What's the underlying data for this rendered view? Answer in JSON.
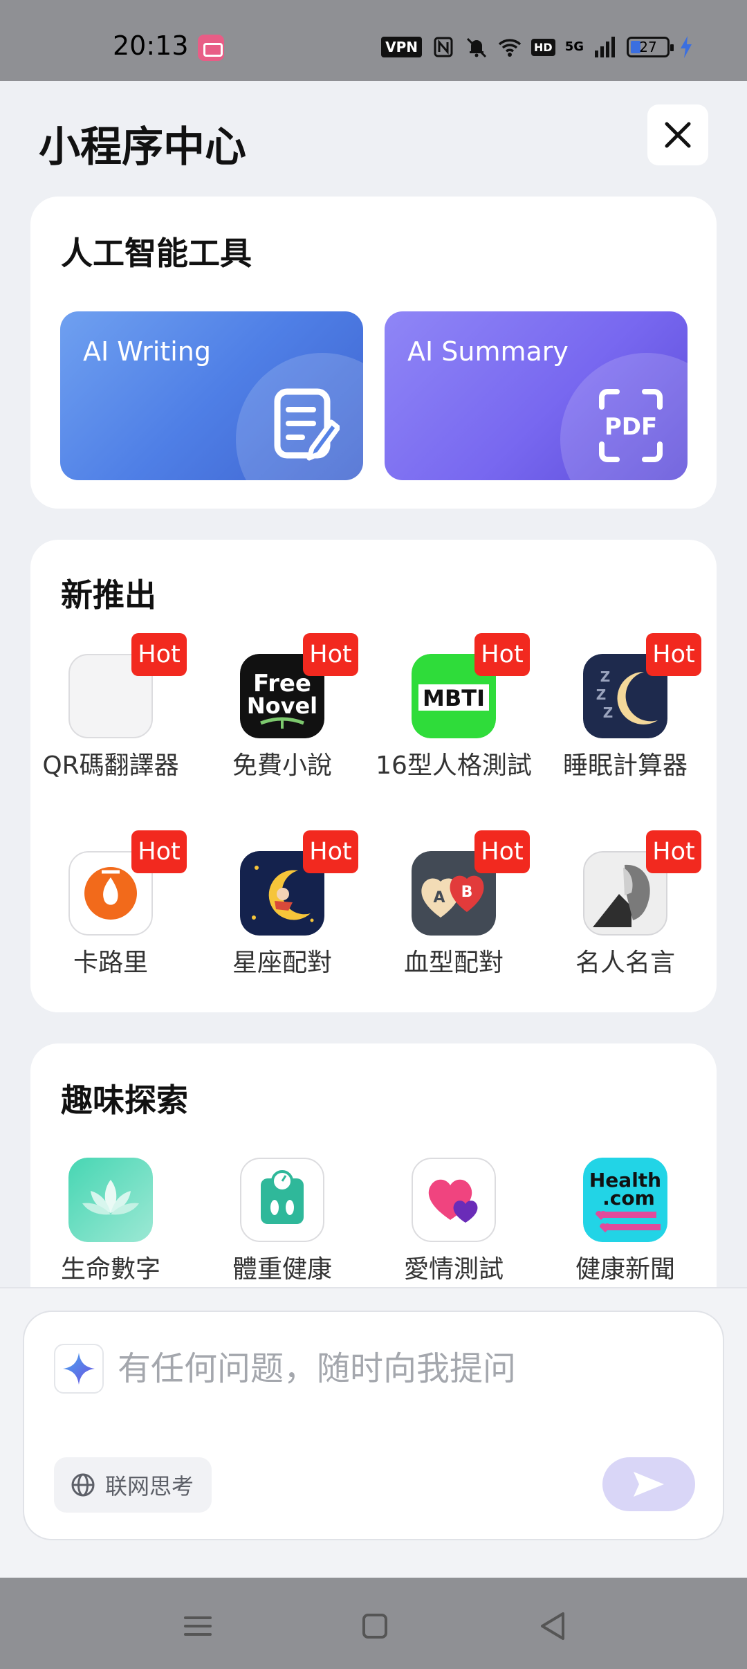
{
  "status": {
    "time": "20:13",
    "vpn": "VPN",
    "hd": "HD",
    "network": "5G",
    "battery": "27"
  },
  "header": {
    "title": "小程序中心"
  },
  "ai_tools": {
    "title": "人工智能工具",
    "tiles": [
      {
        "label": "AI Writing",
        "icon": "edit-document-icon"
      },
      {
        "label": "AI Summary",
        "icon": "pdf-icon"
      }
    ]
  },
  "new_release": {
    "title": "新推出",
    "hot_label": "Hot",
    "apps": [
      {
        "label": "QR碼翻譯器",
        "icon": "qr-translator-icon"
      },
      {
        "label": "免費小說",
        "icon": "free-novel-icon",
        "icon_text_1": "Free",
        "icon_text_2": "Novel"
      },
      {
        "label": "16型人格測試",
        "icon": "mbti-icon",
        "icon_text": "MBTI"
      },
      {
        "label": "睡眠計算器",
        "icon": "sleep-moon-icon",
        "icon_text": "Z Z Z"
      },
      {
        "label": "卡路里",
        "icon": "calorie-flame-icon"
      },
      {
        "label": "星座配對",
        "icon": "zodiac-moon-icon"
      },
      {
        "label": "血型配對",
        "icon": "blood-type-hearts-icon",
        "icon_text_1": "A",
        "icon_text_2": "B"
      },
      {
        "label": "名人名言",
        "icon": "famous-quote-portrait-icon"
      }
    ]
  },
  "fun_explore": {
    "title": "趣味探索",
    "apps": [
      {
        "label": "生命數字",
        "icon": "lotus-icon"
      },
      {
        "label": "體重健康",
        "icon": "weight-scale-icon"
      },
      {
        "label": "愛情測試",
        "icon": "love-hearts-icon"
      },
      {
        "label": "健康新聞",
        "icon": "health-news-icon",
        "icon_text_1": "Health",
        "icon_text_2": ".com"
      }
    ]
  },
  "chat": {
    "placeholder": "有任何问题，随时向我提问",
    "web_think_label": "联网思考"
  },
  "colors": {
    "hot": "#f2291f",
    "writing_tile": "#4f7fe6",
    "summary_tile": "#7868f0",
    "send_button": "#d9d6f7"
  }
}
